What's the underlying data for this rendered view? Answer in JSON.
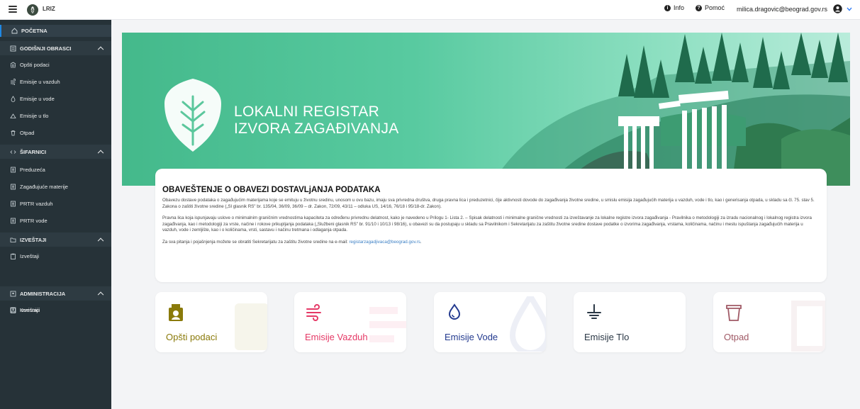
{
  "app": {
    "title": "LRIZ"
  },
  "topbar": {
    "info_label": "Info",
    "help_label": "Pomoć",
    "user_email": "milica.dragovic@beograd.gov.rs"
  },
  "sidebar": {
    "items": [
      {
        "label": "POČETNA",
        "icon": "home-icon"
      },
      {
        "label": "GODIŠNJI OBRASCI",
        "icon": "forms-icon"
      },
      {
        "label": "Opšti podaci",
        "icon": "institution-icon"
      },
      {
        "label": "Emisije u vazduh",
        "icon": "wind-icon"
      },
      {
        "label": "Emisije u vode",
        "icon": "drop-icon"
      },
      {
        "label": "Emisije u tlo",
        "icon": "ground-icon"
      },
      {
        "label": "Otpad",
        "icon": "trash-icon"
      },
      {
        "label": "ŠIFARNICI",
        "icon": "code-icon"
      },
      {
        "label": "Preduzeća",
        "icon": "list-icon"
      },
      {
        "label": "Zagađujuće materije",
        "icon": "list-icon"
      },
      {
        "label": "PRTR vazduh",
        "icon": "list-icon"
      },
      {
        "label": "PRTR vode",
        "icon": "list-icon"
      },
      {
        "label": "IZVEŠTAJI",
        "icon": "folder-icon"
      },
      {
        "label": "Izveštaji",
        "icon": "clipboard-icon"
      },
      {
        "label": "ADMINISTRACIJA",
        "icon": "admin-icon"
      },
      {
        "label": "Korisnici",
        "icon": "user-icon"
      },
      {
        "label": "Izveštaji",
        "icon": "clipboard-icon"
      }
    ]
  },
  "banner": {
    "title_line1": "LOKALNI REGISTAR",
    "title_line2": "IZVORA ZAGAĐIVANJA"
  },
  "notice": {
    "heading": "OBAVEŠTENJE O OBAVEZI DOSTAVLjANJA PODATAKA",
    "p1": "Obavezu dostave podataka o zagađujućim materijama koje se emituju u životnu sredinu, unosom u ovu bazu, imaju sva privredna društva, druga pravna lica i preduzetnici, čije aktivnosti dovode do zagađivanja životne sredine, u smislu emisija zagađujućih materija u vazduh, vode i tlo, kao i generisanja otpada, u skladu sa čl. 75. stav 5. Zakona o zaštiti životne sredine („Sl glasnik RS\" br. 135/04, 36/09, 36/09 – dr. Zakon, 72/09, 43/11 – odluka US, 14/16, 76/18 i 95/18-dr. Zakon).",
    "p2": "Pravna lica koja ispunjavaju uslove o minimalnim graničnim vrednostima kapaciteta za određenu privrednu delatnost, kako je navedeno u Prilogu 1- Lista 2. – Spisak delatnosti i minimalne granične vrednosti za izveštavanje za lokalne registre izvora zagađivanja - Pravilnika o metodologiji za izradu nacionalnog i lokalnog registra izvora zagađivanja, kao i metodologiji za vrste, načine i rokove prikupljanja podataka („Službeni glasnik RS\" br. 91/10 i 10/13 i 98/16), u obavezi su da postupaju u skladu sa Pravilnikom i Sekretarijatu za zaštitu životne sredine dostave podatke o izvorima zagađivanja, vrstama, količinama, načinu i mestu ispuštanja zagađujućih materija u vazduh, vode i zemljište, kao i o količinama, vrsti, sastavu i načinu tretmana i odlaganja otpada.",
    "p3_prefix": "Za sva pitanja i pojašnjenja možete se obratiti Sekretarijatu za zaštitu životne sredine na e-mail: ",
    "p3_email": "registarzagadjivaca@beograd.gov.rs",
    "p3_suffix": "."
  },
  "cards": [
    {
      "label": "Opšti podaci",
      "icon": "badge-icon",
      "color": "#8a7a0a"
    },
    {
      "label": "Emisije Vazduh",
      "icon": "wind-icon",
      "color": "#e53966"
    },
    {
      "label": "Emisije Vode",
      "icon": "drop-icon",
      "color": "#233a8f"
    },
    {
      "label": "Emisije Tlo",
      "icon": "ground-icon",
      "color": "#2b3846"
    },
    {
      "label": "Otpad",
      "icon": "bin-icon",
      "color": "#a05a66"
    }
  ],
  "colors": {
    "sidebar": "#263238",
    "accent": "#1e88e5",
    "banner": "#4cc293"
  }
}
